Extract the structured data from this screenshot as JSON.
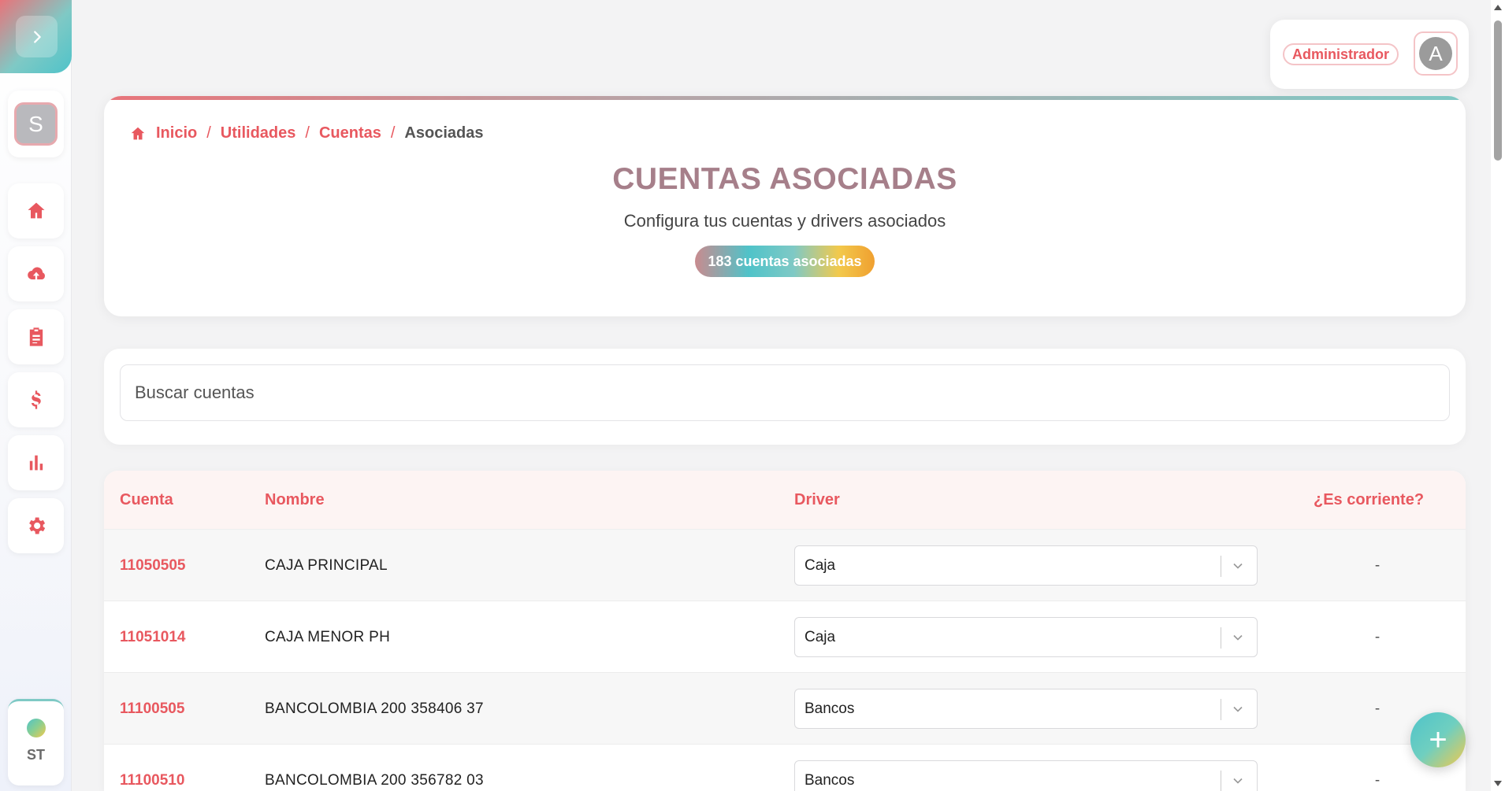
{
  "sidebar": {
    "toggle_icon": "chevron-right-icon",
    "avatar_letter": "S",
    "items": [
      {
        "icon": "home-icon"
      },
      {
        "icon": "cloud-upload-icon"
      },
      {
        "icon": "clipboard-icon"
      },
      {
        "icon": "dollar-icon"
      },
      {
        "icon": "bar-chart-icon"
      },
      {
        "icon": "gear-icon"
      }
    ],
    "footer_label": "ST"
  },
  "user": {
    "role": "Administrador",
    "avatar_letter": "A"
  },
  "breadcrumb": {
    "items": [
      "Inicio",
      "Utilidades",
      "Cuentas"
    ],
    "current": "Asociadas",
    "separator": "/"
  },
  "header": {
    "title": "CUENTAS ASOCIADAS",
    "subtitle": "Configura tus cuentas y drivers asociados",
    "count_badge": "183 cuentas asociadas"
  },
  "search": {
    "placeholder": "Buscar cuentas"
  },
  "table": {
    "columns": {
      "cuenta": "Cuenta",
      "nombre": "Nombre",
      "driver": "Driver",
      "corriente": "¿Es corriente?"
    },
    "rows": [
      {
        "cuenta": "11050505",
        "nombre": "CAJA PRINCIPAL",
        "driver": "Caja",
        "corriente": "-"
      },
      {
        "cuenta": "11051014",
        "nombre": "CAJA MENOR PH",
        "driver": "Caja",
        "corriente": "-"
      },
      {
        "cuenta": "11100505",
        "nombre": "BANCOLOMBIA 200 358406 37",
        "driver": "Bancos",
        "corriente": "-"
      },
      {
        "cuenta": "11100510",
        "nombre": "BANCOLOMBIA 200 356782 03",
        "driver": "Bancos",
        "corriente": "-"
      }
    ]
  },
  "fab": {
    "label": "+"
  },
  "colors": {
    "accent": "#e8585f",
    "teal": "#4fc3c9",
    "yellow": "#f2c94c"
  }
}
